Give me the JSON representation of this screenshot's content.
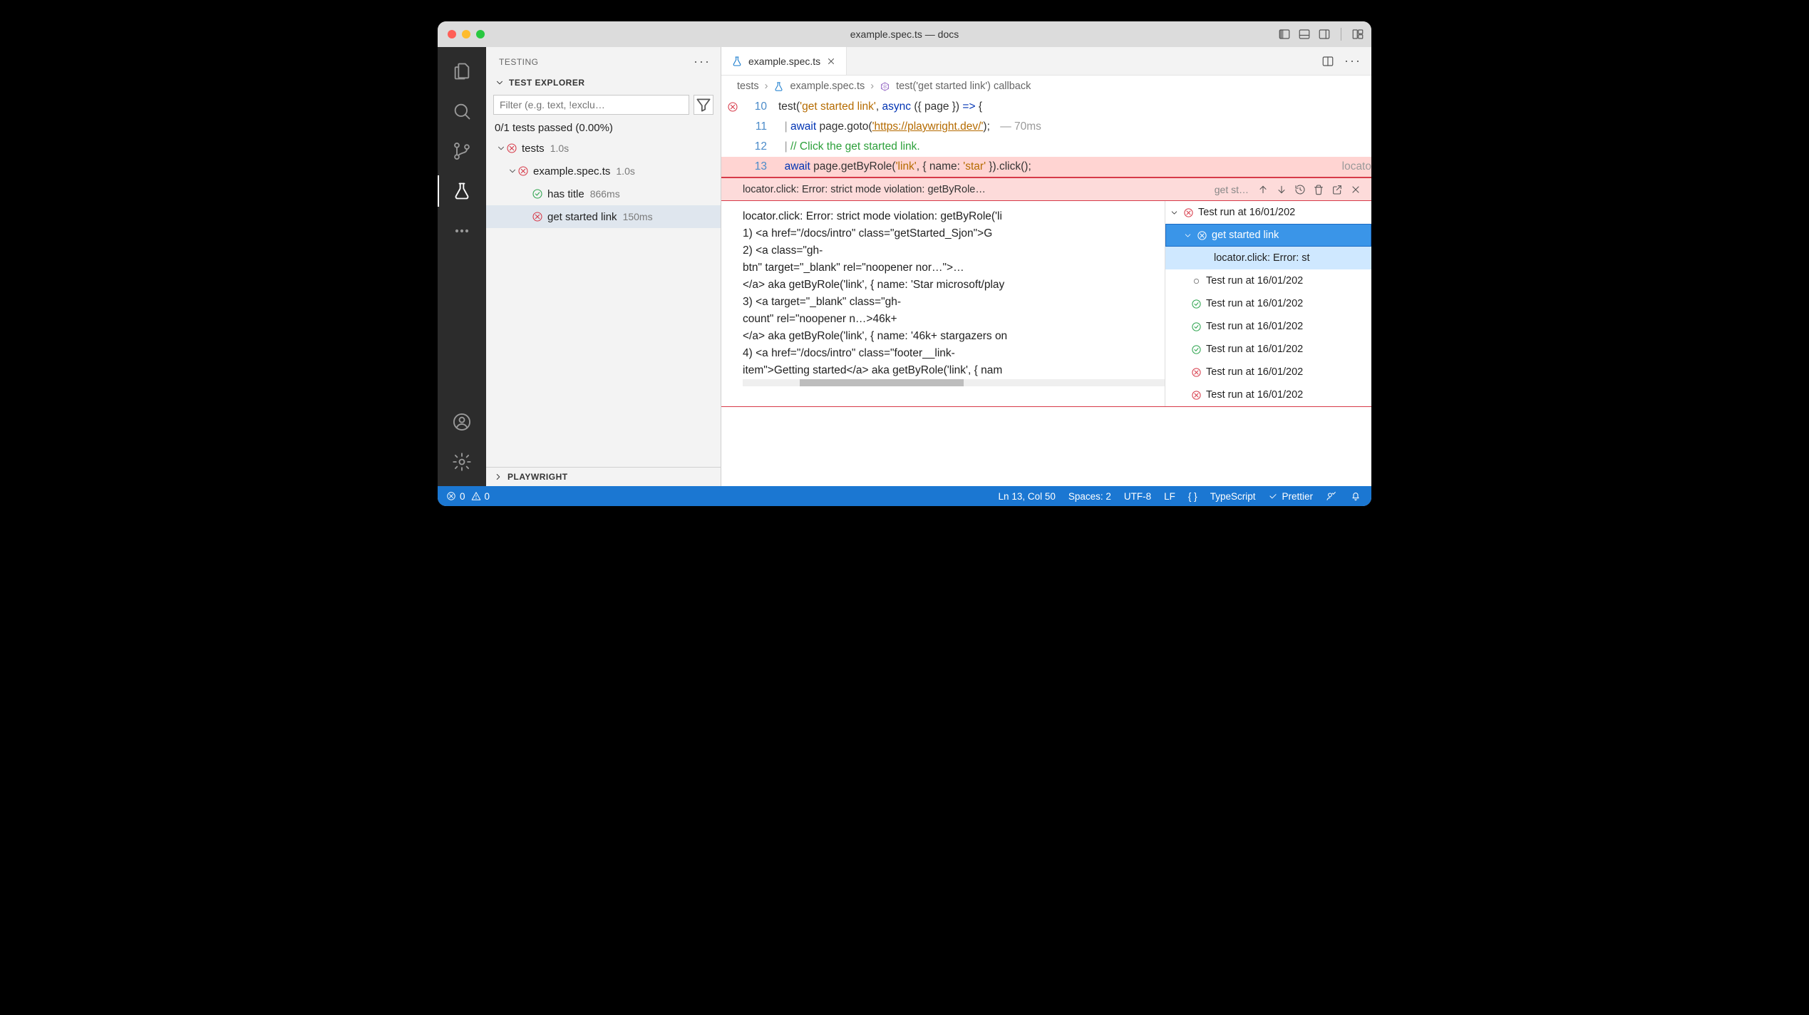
{
  "window": {
    "title": "example.spec.ts — docs"
  },
  "sidebar": {
    "header": "TESTING",
    "section": "TEST EXPLORER",
    "filter_placeholder": "Filter (e.g. text, !exclu…",
    "pass_summary": "0/1 tests passed (0.00%)",
    "tree": [
      {
        "label": "tests",
        "status": "fail",
        "duration": "1.0s"
      },
      {
        "label": "example.spec.ts",
        "status": "fail",
        "duration": "1.0s"
      },
      {
        "label": "has title",
        "status": "pass",
        "duration": "866ms"
      },
      {
        "label": "get started link",
        "status": "fail",
        "duration": "150ms"
      }
    ],
    "footer_section": "PLAYWRIGHT"
  },
  "editor": {
    "tab_label": "example.spec.ts",
    "breadcrumbs": [
      "tests",
      "example.spec.ts",
      "test('get started link') callback"
    ],
    "lines": {
      "10": {
        "pre": "test(",
        "str": "'get started link'",
        "mid": ", ",
        "kw": "async",
        "rest": " ({ page }) ",
        "arrow": "=>",
        "end": " {"
      },
      "11": {
        "indent": "  ",
        "vert": "| ",
        "kw": "await",
        "call": " page.goto(",
        "link": "'https://playwright.dev/'",
        "end": ");",
        "trail": " — 70ms"
      },
      "12": {
        "indent": "  ",
        "vert": "| ",
        "cmt": "// Click the get started link."
      },
      "13": {
        "indent": "  ",
        "kw": "await",
        "call": " page.getByRole(",
        "s1": "'link'",
        "mid": ", { name: ",
        "s2": "'star'",
        "end": " }).click();",
        "trail": "locato"
      }
    },
    "error_summary": "locator.click: Error: strict mode violation: getByRole…",
    "error_short": "get st…",
    "error_body": [
      "locator.click: Error: strict mode violation: getByRole('li",
      "    1) <a href=\"/docs/intro\" class=\"getStarted_Sjon\">G",
      "    2) <a class=\"gh-",
      "btn\" target=\"_blank\" rel=\"noopener nor…\">…",
      "</a> aka getByRole('link', { name: 'Star microsoft/play",
      "    3) <a target=\"_blank\" class=\"gh-",
      "count\" rel=\"noopener n…>46k+",
      "</a> aka getByRole('link', { name: '46k+ stargazers on",
      "    4) <a href=\"/docs/intro\" class=\"footer__link-",
      "item\">Getting started</a> aka getByRole('link', { nam"
    ],
    "runs": [
      {
        "label": "Test run at 16/01/202",
        "status": "fail",
        "sel": "cur"
      },
      {
        "label": "get started link",
        "status": "fail",
        "sel": "focus"
      },
      {
        "label": "locator.click: Error: st",
        "status": "none",
        "sel": "hl"
      },
      {
        "label": "Test run at 16/01/202",
        "status": "pending"
      },
      {
        "label": "Test run at 16/01/202",
        "status": "pass"
      },
      {
        "label": "Test run at 16/01/202",
        "status": "pass"
      },
      {
        "label": "Test run at 16/01/202",
        "status": "pass"
      },
      {
        "label": "Test run at 16/01/202",
        "status": "fail"
      },
      {
        "label": "Test run at 16/01/202",
        "status": "fail"
      }
    ]
  },
  "statusbar": {
    "errors": "0",
    "warnings": "0",
    "cursor": "Ln 13, Col 50",
    "indent": "Spaces: 2",
    "encoding": "UTF-8",
    "eol": "LF",
    "lang": "TypeScript",
    "prettier": "Prettier"
  }
}
